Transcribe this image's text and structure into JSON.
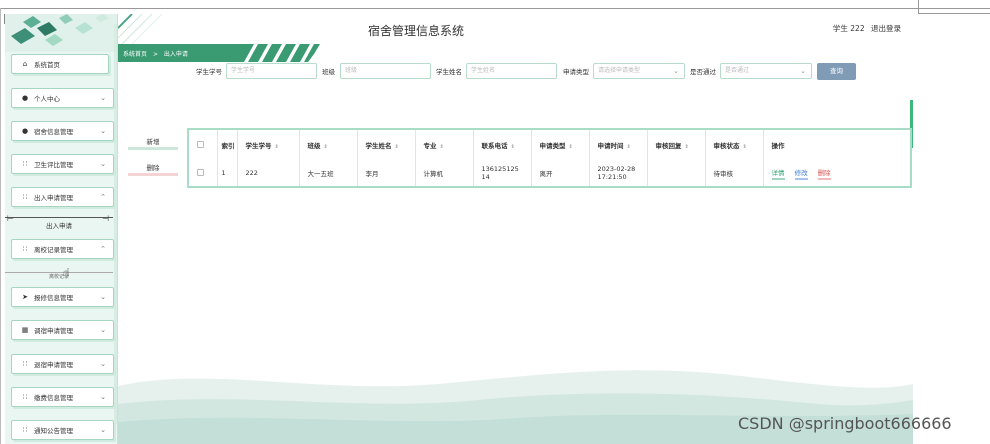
{
  "header": {
    "title": "宿舍管理信息系统",
    "user_name": "学生 222",
    "logout_label": "退出登录"
  },
  "breadcrumb": {
    "home": "系统首页",
    "separator": ">",
    "current": "出入申请"
  },
  "sidebar": {
    "items": [
      {
        "label": "系统首页",
        "icon": "home-icon"
      },
      {
        "label": "个人中心",
        "icon": "user-icon"
      },
      {
        "label": "宿舍信息管理",
        "icon": "user-icon"
      },
      {
        "label": "卫生评比管理",
        "icon": "grid-icon"
      },
      {
        "label": "出入申请管理",
        "icon": "grid-icon"
      },
      {
        "label": "离校记录管理",
        "icon": "grid-icon"
      },
      {
        "label": "报修信息管理",
        "icon": "send-icon"
      },
      {
        "label": "调宿申请管理",
        "icon": "clipboard-icon"
      },
      {
        "label": "退宿申请管理",
        "icon": "grid-icon"
      },
      {
        "label": "缴费信息管理",
        "icon": "grid-icon"
      },
      {
        "label": "通知公告管理",
        "icon": "grid-icon"
      }
    ],
    "submenu_open": "出入申请",
    "submenu_faded": "离校记录"
  },
  "search": {
    "student_no_label": "学生学号",
    "student_no_placeholder": "学生学号",
    "class_label": "班级",
    "class_placeholder": "班级",
    "student_name_label": "学生姓名",
    "student_name_placeholder": "学生姓名",
    "apply_type_label": "申请类型",
    "apply_type_placeholder": "请选择申请类型",
    "approved_label": "是否通过",
    "approved_placeholder": "是否通过",
    "query_button": "查询"
  },
  "actions": {
    "add": "新增",
    "delete": "删除"
  },
  "table": {
    "columns": [
      "索引",
      "学生学号",
      "班级",
      "学生姓名",
      "专业",
      "联系电话",
      "申请类型",
      "申请时间",
      "审核回复",
      "审核状态",
      "操作"
    ],
    "rows": [
      {
        "index": "1",
        "student_no": "222",
        "class": "大一五班",
        "name": "李月",
        "major": "计算机",
        "phone_a": "136125125",
        "phone_b": "14",
        "apply_type": "离开",
        "apply_date": "2023-02-28",
        "apply_time": "17:21:50",
        "reply": "",
        "status": "待审核",
        "op_detail": "详情",
        "op_edit": "修改",
        "op_delete": "删除"
      }
    ]
  },
  "watermark": "CSDN @springboot666666",
  "colors": {
    "accent_green": "#3a9a72",
    "query_button": "#7f9bb5",
    "sidebar_bg": "#eaf6f1"
  }
}
